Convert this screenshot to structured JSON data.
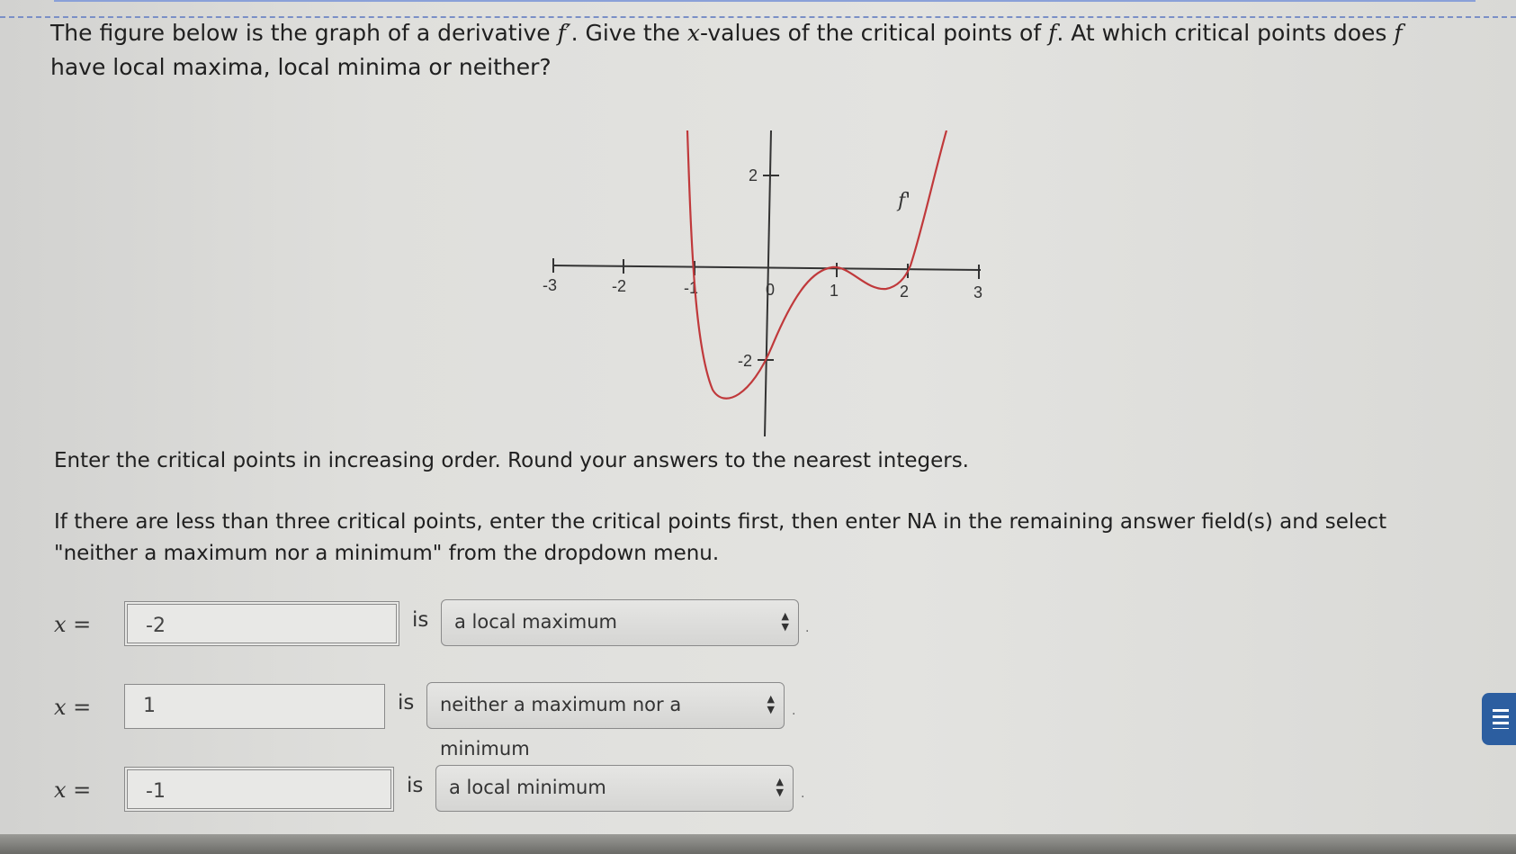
{
  "question": {
    "part1": "The figure below is the graph of a derivative ",
    "fprime": "f′",
    "part2": ". Give the ",
    "x": "x",
    "part3": "-values of the critical points of ",
    "f1": "f",
    "part4": ". At which critical points does ",
    "f2": "f",
    "part5": " have local maxima, local minima or neither?"
  },
  "graph": {
    "curve_label": "f'",
    "x_ticks": [
      "-3",
      "-2",
      "-1",
      "0",
      "1",
      "2",
      "3"
    ],
    "y_ticks": [
      "2",
      "-2"
    ],
    "curve_color": "#c0393b"
  },
  "instruction": "Enter the critical points in increasing order. Round your answers to the nearest integers.",
  "instruction2": "If there are less than three critical points, enter the critical points first, then enter NA in the remaining answer field(s) and select \"neither a maximum nor a minimum\" from the dropdown menu.",
  "answers": [
    {
      "x_label": "x =",
      "value": "-2",
      "is": "is",
      "choice": "a local maximum",
      "end": "."
    },
    {
      "x_label": "x =",
      "value": "1",
      "is": "is",
      "choice": "neither a maximum nor a minimum",
      "end": "."
    },
    {
      "x_label": "x =",
      "value": "-1",
      "is": "is",
      "choice": "a local minimum",
      "end": "."
    }
  ],
  "colors": {
    "accent": "#2c5ea0",
    "border": "#8a8a8a"
  }
}
